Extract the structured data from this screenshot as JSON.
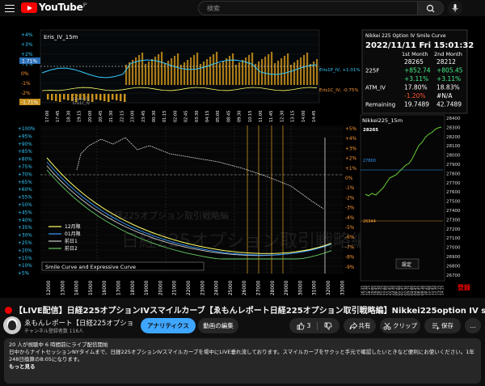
{
  "header": {
    "brand": "YouTube",
    "brand_region": "JP",
    "search_placeholder": "検索"
  },
  "video": {
    "panel_title": "Eris_IV_15m",
    "bottom_panel_title": "Smile Curve and Expressive Curve",
    "nikkei_panel_title": "Nikkei225_15m",
    "nikkei_price_label": "28265",
    "settings_label": "設定",
    "register_label": "登録",
    "watermark": "日経225オプション取引戦略編",
    "top_axis_labels": [
      "+4%",
      "+3%",
      "+2%",
      "+1%",
      "0%",
      "-1%",
      "-2%",
      "-3%"
    ],
    "top_series_labels": [
      "Eris1P_IV, +1.01%",
      "Eris1C_IV, -0.75%"
    ],
    "top_left_badges": [
      "1.71%",
      "-1.71%"
    ],
    "inner_labels": [
      "Prv_Dif_1",
      "Eris1P_IV",
      "Eris1C_IV"
    ],
    "left_axis_labels": [
      "+100%",
      "+95%",
      "+90%",
      "+85%",
      "+80%",
      "+75%",
      "+70%",
      "+65%",
      "+60%",
      "+55%",
      "+50%",
      "+45%",
      "+40%",
      "+35%",
      "+30%",
      "+25%",
      "+20%",
      "+15%",
      "+10%",
      "+5%"
    ],
    "right_axis_labels": [
      "+5%",
      "+4%",
      "+3%",
      "+2%",
      "+1%",
      "0%",
      "-1%",
      "-2%",
      "-3%",
      "-4%",
      "-5%",
      "-6%",
      "-7%",
      "-8%",
      "-9%"
    ],
    "legend": [
      "12月限",
      "01月限",
      "前日1",
      "前日2"
    ],
    "legend_colors": [
      "#ffff66",
      "#3399ff",
      "#cccccc",
      "#66cc66"
    ],
    "top_time_labels": [
      "17:00",
      "17:45",
      "18:30",
      "19:15",
      "20:00",
      "20:45",
      "21:30",
      "22:15",
      "23:00",
      "23:45",
      "00:30",
      "01:15",
      "02:00",
      "02:45",
      "03:30",
      "04:15",
      "05:00",
      "08:45",
      "09:30",
      "10:15",
      "11:00",
      "11:45",
      "12:30",
      "13:15",
      "14:00",
      "14:45"
    ],
    "strike_labels": [
      "12000",
      "13000",
      "14000",
      "15000",
      "16000",
      "17000",
      "18000",
      "19000",
      "20000",
      "21000",
      "22000",
      "23000",
      "24000",
      "25000",
      "26000",
      "27000",
      "28000",
      "29000",
      "30000",
      "31000",
      "32000",
      "33000"
    ],
    "nikkei_axis_labels": [
      "28400",
      "28300",
      "28200",
      "28100",
      "28000",
      "27900",
      "27800",
      "27700",
      "27600",
      "27500",
      "27400",
      "27300",
      "27200",
      "27100",
      "27000",
      "26900",
      "26800",
      "26700"
    ],
    "nikkei_markers": [
      "27800",
      "26944"
    ],
    "nikkei_time_labels": [
      "16:35",
      "17:30",
      "18:15",
      "19:00",
      "19:45",
      "20:30",
      "21:15",
      "22:00",
      "22:45",
      "23:30",
      "00:15",
      "01:00",
      "01:45",
      "02:30",
      "03:15",
      "04:00",
      "04:45",
      "08:45",
      "09:30",
      "10:15",
      "11:00",
      "11:45",
      "12:30",
      "13:15",
      "14:15"
    ]
  },
  "smile_table": {
    "title": "Nikkei 225 Option IV Smile Curve",
    "datetime": "2022/11/11 Fri 15:01:32",
    "col_headers": [
      "1st Month",
      "2nd Month"
    ],
    "rows": [
      {
        "label": "",
        "values": [
          "28265",
          "28212"
        ]
      },
      {
        "label": "225F",
        "values": [
          "+852.74",
          "+805.45"
        ]
      },
      {
        "label": "",
        "values": [
          "+3.11%",
          "+3.11%"
        ]
      },
      {
        "label": "ATM_IV",
        "values": [
          "17.80%",
          "18.83%"
        ]
      },
      {
        "label": "",
        "values": [
          "-1.20%",
          "#N/A"
        ]
      },
      {
        "label": "Remaining",
        "values": [
          "19.7489",
          "42.7489"
        ]
      }
    ]
  },
  "title": "【LIVE配信】日経225オプションIVスマイルカーブ【ゑもんレポート日経225オプション取引戦略編】Nikkei225option IV smile curve",
  "channel": {
    "name": "ゑもんレポート【日経225オプショ...",
    "subscribers": "チャンネル登録者数 116人"
  },
  "actions": {
    "analytics": "アナリティクス",
    "edit": "動画の編集",
    "likes": "3",
    "share": "共有",
    "clip": "クリップ",
    "save": "保存",
    "more": "…"
  },
  "description": {
    "stats": "20 人が視聴中 6 時間前にライブ配信開始",
    "body": "日中からナイトセッションNYタイムまで、日経225オプションIVスマイルカーブを場中にLIVE垂れ流しております。スマイルカーブをサクッと手元で確認したいときなど便利にお使いください。1年248日換算の8:05になります。",
    "more": "もっと見る"
  },
  "colors": {
    "brand_red": "#ff0000",
    "accent_blue": "#3ea6ff",
    "chart_yellow": "#ffff66",
    "chart_orange": "#c8921e",
    "chart_cyan": "#33ccff",
    "chart_green": "#66cc33"
  }
}
